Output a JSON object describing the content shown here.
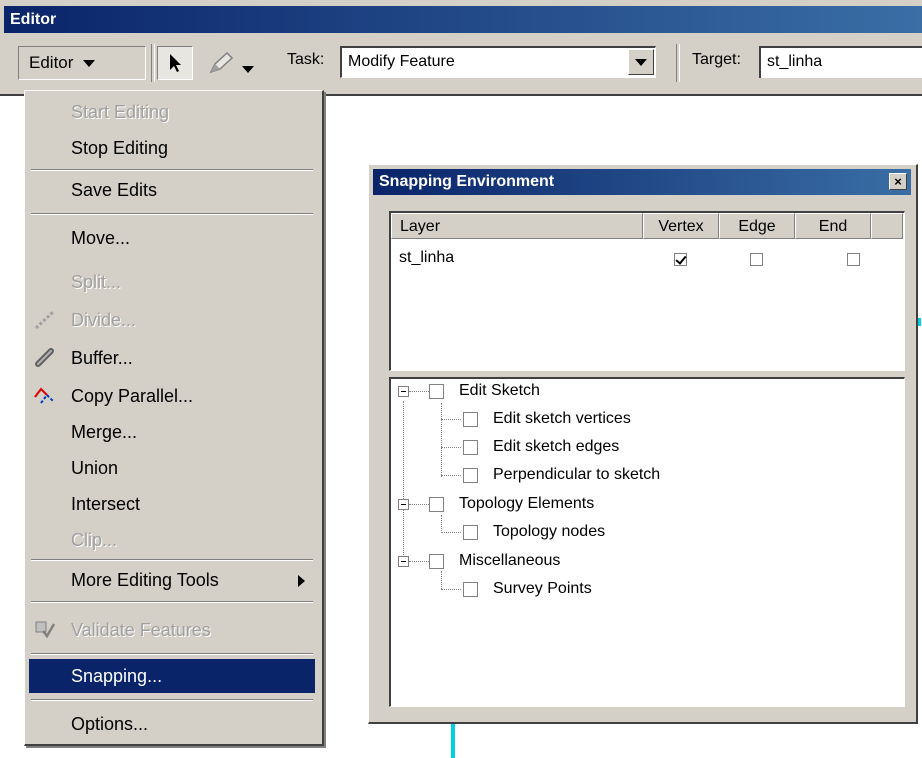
{
  "editor_window": {
    "title": "Editor",
    "editor_menu_label": "Editor",
    "task_label": "Task:",
    "task_value": "Modify Feature",
    "target_label": "Target:",
    "target_value": "st_linha"
  },
  "menu": {
    "start_editing": "Start Editing",
    "stop_editing": "Stop Editing",
    "save_edits": "Save Edits",
    "move": "Move...",
    "split": "Split...",
    "divide": "Divide...",
    "buffer": "Buffer...",
    "copy_parallel": "Copy Parallel...",
    "merge": "Merge...",
    "union": "Union",
    "intersect": "Intersect",
    "clip": "Clip...",
    "more_editing_tools": "More Editing Tools",
    "validate_features": "Validate Features",
    "snapping": "Snapping...",
    "options": "Options..."
  },
  "snapping": {
    "title": "Snapping Environment",
    "columns": {
      "layer": "Layer",
      "vertex": "Vertex",
      "edge": "Edge",
      "end": "End"
    },
    "rows": [
      {
        "layer": "st_linha",
        "vertex": true,
        "edge": false,
        "end": false
      }
    ],
    "tree": {
      "edit_sketch": "Edit Sketch",
      "edit_sketch_vertices": "Edit sketch vertices",
      "edit_sketch_edges": "Edit sketch edges",
      "perpendicular_to_sketch": "Perpendicular to sketch",
      "topology_elements": "Topology Elements",
      "topology_nodes": "Topology nodes",
      "miscellaneous": "Miscellaneous",
      "survey_points": "Survey Points"
    }
  },
  "colors": {
    "titlebar": "#0a246a",
    "face": "#d4d0c8",
    "selection": "#0a246a",
    "map_feature": "#00d0e0"
  }
}
